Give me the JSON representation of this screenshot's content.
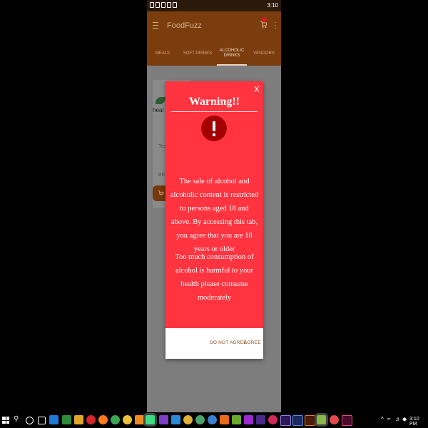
{
  "status_bar": {
    "time": "3:10"
  },
  "app": {
    "title": "FoodFuzz"
  },
  "tabs": [
    {
      "label": "MEALS"
    },
    {
      "label": "SOFT DRINKS"
    },
    {
      "label": "ALCOHOLIC DRINKS"
    },
    {
      "label": "VENDORS"
    }
  ],
  "background": {
    "logo_text": "heal",
    "side_text1": "Tes",
    "side_text2": "BE"
  },
  "dialog": {
    "close_label": "X",
    "title": "Warning!!",
    "message1": "The sale of alcohol and alcoholic content is restricted to persons aged 18 and above. By accessing this tab, you agree that you are 18 years or older",
    "message2": "Too much consumption of alcohol is harmful to your health please consume moderately",
    "do_not_agree": "DO NOT AGREE",
    "agree": "AGREE"
  },
  "colors": {
    "app_brown": "#7b3d0d",
    "dialog_red": "#ff3440",
    "alert_dark_red": "#a40004",
    "button_text": "#8c4c1f"
  },
  "taskbar": {
    "time": "3:10 PM",
    "apps": [
      "task-view",
      "edge",
      "terminal",
      "file-explorer",
      "opera",
      "firefox",
      "chrome",
      "brave",
      "firefox-nightly",
      "android-studio",
      "visual-studio",
      "vscode",
      "chrome-canary",
      "browser",
      "filezilla",
      "notepad-plus",
      "app-store",
      "premiere",
      "photoshop",
      "after-effects",
      "illustrator",
      "lightroom",
      "emulator",
      "record",
      "indesign"
    ]
  }
}
